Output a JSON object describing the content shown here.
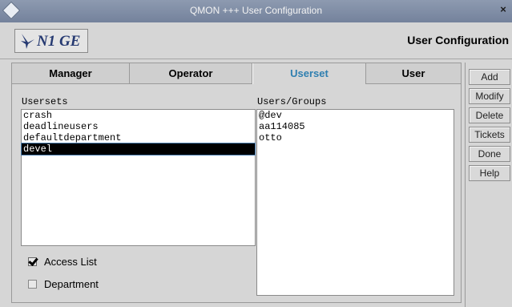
{
  "window": {
    "title": "QMON +++ User Configuration",
    "close_glyph": "×"
  },
  "header": {
    "logo_text": "N1 GE",
    "title": "User Configuration"
  },
  "tabs": [
    {
      "label": "Manager",
      "active": false
    },
    {
      "label": "Operator",
      "active": false
    },
    {
      "label": "Userset",
      "active": true
    },
    {
      "label": "User",
      "active": false
    }
  ],
  "usersets": {
    "label": "Usersets",
    "items": [
      "crash",
      "deadlineusers",
      "defaultdepartment",
      "devel"
    ],
    "selected": "devel"
  },
  "users_groups": {
    "label": "Users/Groups",
    "items": [
      "@dev",
      "aa114085",
      "otto"
    ]
  },
  "checkboxes": {
    "access_list": {
      "label": "Access List",
      "checked": true
    },
    "department": {
      "label": "Department",
      "checked": false
    }
  },
  "buttons": {
    "add": "Add",
    "modify": "Modify",
    "delete": "Delete",
    "tickets": "Tickets",
    "done": "Done",
    "help": "Help"
  },
  "colors": {
    "active_tab_text": "#2f7fb0",
    "selection_bg": "#000000",
    "titlebar": "#7f8ca4"
  }
}
